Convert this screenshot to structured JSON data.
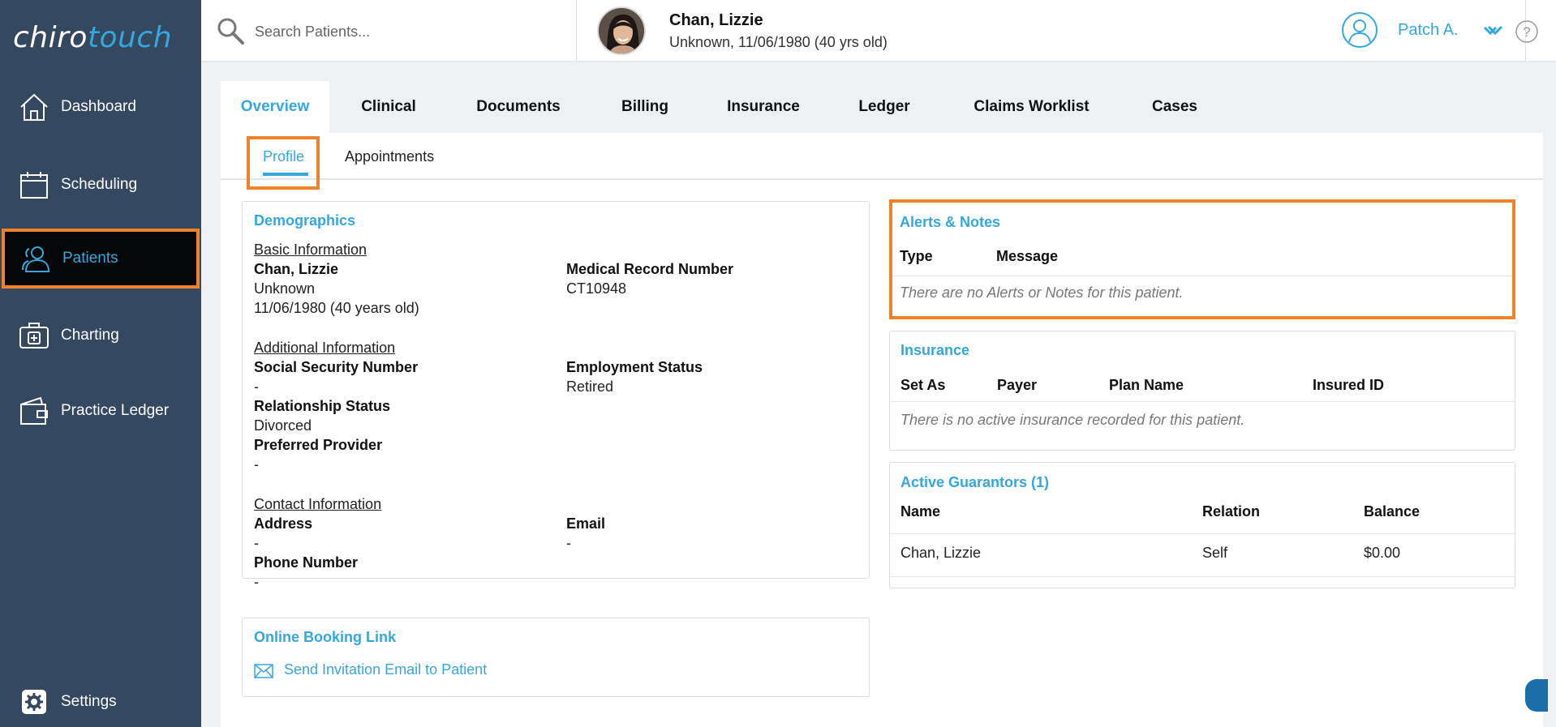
{
  "app": {
    "logo_part1": "chiro",
    "logo_part2": "touch"
  },
  "sidebar": {
    "items": [
      {
        "label": "Dashboard",
        "icon": "home-icon"
      },
      {
        "label": "Scheduling",
        "icon": "calendar-icon"
      },
      {
        "label": "Patients",
        "icon": "patients-icon",
        "active": true
      },
      {
        "label": "Charting",
        "icon": "medical-case-icon"
      },
      {
        "label": "Practice Ledger",
        "icon": "wallet-icon"
      },
      {
        "label": "Settings",
        "icon": "gear-icon"
      }
    ]
  },
  "search": {
    "placeholder": "Search Patients..."
  },
  "patient": {
    "name": "Chan, Lizzie",
    "subtitle": "Unknown, 11/06/1980 (40 yrs old)"
  },
  "user": {
    "name": "Patch A."
  },
  "tabs": [
    "Overview",
    "Clinical",
    "Documents",
    "Billing",
    "Insurance",
    "Ledger",
    "Claims Worklist",
    "Cases"
  ],
  "subtabs": [
    "Profile",
    "Appointments"
  ],
  "demographics": {
    "title": "Demographics",
    "basic_heading": "Basic Information",
    "name": "Chan, Lizzie",
    "gender": "Unknown",
    "dob": "11/06/1980 (40 years old)",
    "mrn_label": "Medical Record Number",
    "mrn_value": "CT10948",
    "additional_heading": "Additional Information",
    "ssn_label": "Social Security Number",
    "ssn_value": "-",
    "employment_label": "Employment Status",
    "employment_value": "Retired",
    "relationship_label": "Relationship Status",
    "relationship_value": "Divorced",
    "provider_label": "Preferred Provider",
    "provider_value": "-",
    "contact_heading": "Contact Information",
    "address_label": "Address",
    "address_value": "-",
    "email_label": "Email",
    "email_value": "-",
    "phone_label": "Phone Number",
    "phone_value": "-"
  },
  "booking": {
    "title": "Online Booking Link",
    "link": "Send Invitation Email to Patient"
  },
  "alerts": {
    "title": "Alerts & Notes",
    "col_type": "Type",
    "col_message": "Message",
    "empty": "There are no Alerts or Notes for this patient."
  },
  "insurance": {
    "title": "Insurance",
    "col_set_as": "Set As",
    "col_payer": "Payer",
    "col_plan": "Plan Name",
    "col_insured": "Insured ID",
    "empty": "There is no active insurance recorded for this patient."
  },
  "guarantors": {
    "title": "Active Guarantors (1)",
    "col_name": "Name",
    "col_relation": "Relation",
    "col_balance": "Balance",
    "rows": [
      {
        "name": "Chan, Lizzie",
        "relation": "Self",
        "balance": "$0.00"
      }
    ]
  },
  "colors": {
    "sidebar": "#34485f",
    "accent": "#35a7dc",
    "highlight": "#f0822a"
  }
}
